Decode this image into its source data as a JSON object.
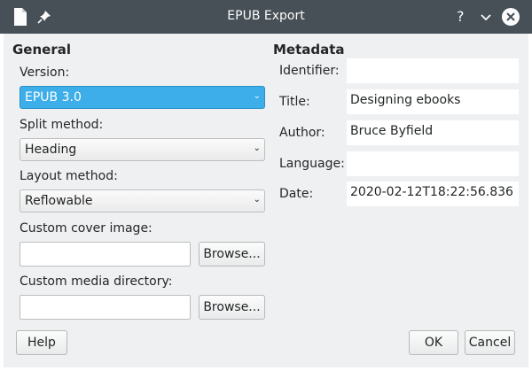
{
  "window": {
    "title": "EPUB Export"
  },
  "general": {
    "heading": "General",
    "version_label": "Version:",
    "version_value": "EPUB 3.0",
    "split_label": "Split method:",
    "split_value": "Heading",
    "layout_label": "Layout method:",
    "layout_value": "Reflowable",
    "cover_label": "Custom cover image:",
    "cover_value": "",
    "media_label": "Custom media directory:",
    "media_value": "",
    "browse_label": "Browse..."
  },
  "metadata": {
    "heading": "Metadata",
    "identifier_label": "Identifier:",
    "identifier_value": "",
    "title_label": "Title:",
    "title_value": "Designing ebooks",
    "author_label": "Author:",
    "author_value": "Bruce Byfield",
    "language_label": "Language:",
    "language_value": "",
    "date_label": "Date:",
    "date_value": "2020-02-12T18:22:56.836"
  },
  "buttons": {
    "help": "Help",
    "ok": "OK",
    "cancel": "Cancel"
  },
  "icons": {
    "document": "document-icon",
    "pin": "pin-icon",
    "help": "help-icon",
    "minimize": "chevron-down-icon",
    "close": "close-icon"
  },
  "colors": {
    "titlebar": "#475057",
    "accent": "#3daee9",
    "panel": "#eff0f1"
  }
}
